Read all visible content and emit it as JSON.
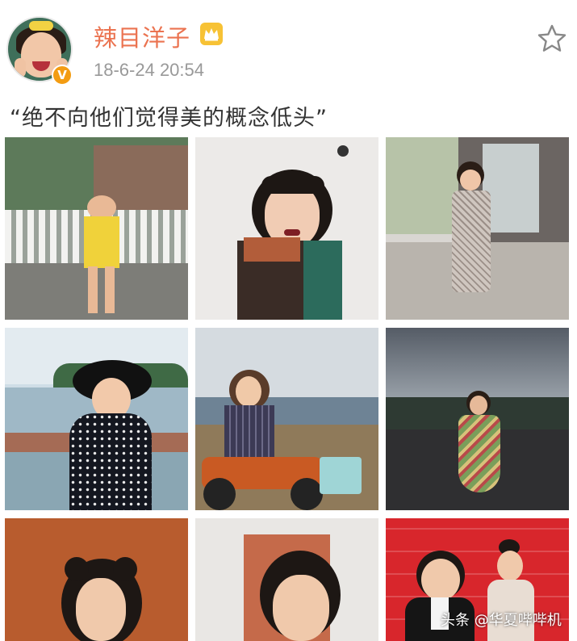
{
  "post": {
    "username": "辣目洋子",
    "timestamp": "18-6-24 20:54",
    "text": "“绝不向他们觉得美的概念低头”",
    "verified_badge": "V"
  },
  "icons": {
    "avatar": "user-avatar",
    "verified": "verified-badge-icon",
    "member": "crown-icon",
    "favorite": "star-icon"
  },
  "colors": {
    "username": "#eb7350",
    "timestamp": "#999999",
    "text": "#333333",
    "badge": "#f39c12",
    "crown": "#f7c235"
  },
  "photos": [
    {
      "description": "girl-in-yellow-top-white-fence"
    },
    {
      "description": "girl-holding-bouquet-white-wall"
    },
    {
      "description": "girl-in-plaid-dress-street"
    },
    {
      "description": "girl-in-black-hat-by-lake"
    },
    {
      "description": "girl-on-atv-mountains"
    },
    {
      "description": "girl-in-floral-dress-road"
    },
    {
      "description": "girl-portrait-orange-background"
    },
    {
      "description": "girl-portrait-doorway"
    },
    {
      "description": "red-carpet-event"
    }
  ],
  "watermark": "头条 @华夏哔哔机"
}
